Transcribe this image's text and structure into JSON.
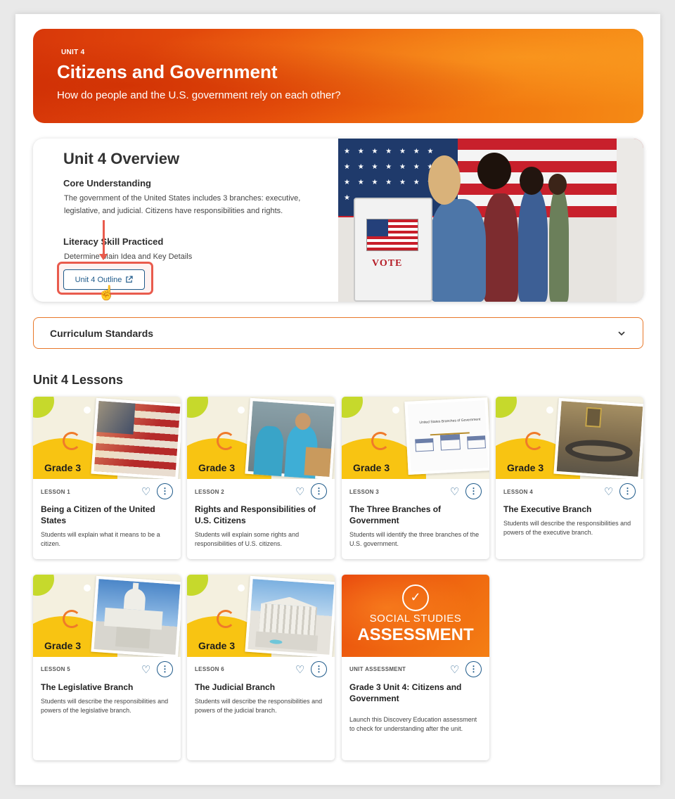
{
  "hero": {
    "kicker": "UNIT 4",
    "title": "Citizens and Government",
    "question": "How do people and the U.S. government rely on each other?"
  },
  "overview": {
    "title": "Unit 4 Overview",
    "core_heading": "Core Understanding",
    "core_text": "The government of the United States includes 3 branches: executive, legislative, and judicial. Citizens have responsibilities and rights.",
    "literacy_heading": "Literacy Skill Practiced",
    "literacy_text": "Determine Main Idea and Key Details",
    "outline_button": "Unit 4 Outline",
    "photo_sign": "VOTE"
  },
  "standards": {
    "label": "Curriculum Standards"
  },
  "lessons_title": "Unit 4 Lessons",
  "cards": [
    {
      "grade": "Grade 3",
      "meta": "LESSON 1",
      "title": "Being a Citizen of the United States",
      "desc": "Students will explain what it means to be a citizen."
    },
    {
      "grade": "Grade 3",
      "meta": "LESSON 2",
      "title": "Rights and Responsibilities of U.S. Citizens",
      "desc": "Students will explain some rights and responsibilities of U.S. citizens."
    },
    {
      "grade": "Grade 3",
      "meta": "LESSON 3",
      "title": "The Three Branches of Government",
      "desc": "Students will identify the three branches of the U.S. government.",
      "pic_caption": "United States Branches of Government"
    },
    {
      "grade": "Grade 3",
      "meta": "LESSON 4",
      "title": "The Executive Branch",
      "desc": "Students will describe the responsibilities and powers of the executive branch."
    },
    {
      "grade": "Grade 3",
      "meta": "LESSON 5",
      "title": "The Legislative Branch",
      "desc": "Students will describe the responsibilities and powers of the legislative branch."
    },
    {
      "grade": "Grade 3",
      "meta": "LESSON 6",
      "title": "The Judicial Branch",
      "desc": "Students will describe the responsibilities and powers of the judicial branch."
    },
    {
      "meta": "UNIT ASSESSMENT",
      "title": "Grade 3 Unit 4: Citizens and Government",
      "desc": "Launch this Discovery Education assessment to check for understanding after the unit.",
      "banner_line1": "SOCIAL STUDIES",
      "banner_line2": "ASSESSMENT"
    }
  ],
  "icons": {
    "favorite": "heart-outline-icon",
    "more": "vertical-dots-icon",
    "external": "external-link-icon",
    "chevron": "chevron-down-icon",
    "assessment": "check-circle-icon"
  },
  "colors": {
    "brand_orange": "#e8520c",
    "link_blue": "#1e5a8a",
    "highlight_red": "#e95b4d",
    "grade_yellow": "#f8c412"
  }
}
